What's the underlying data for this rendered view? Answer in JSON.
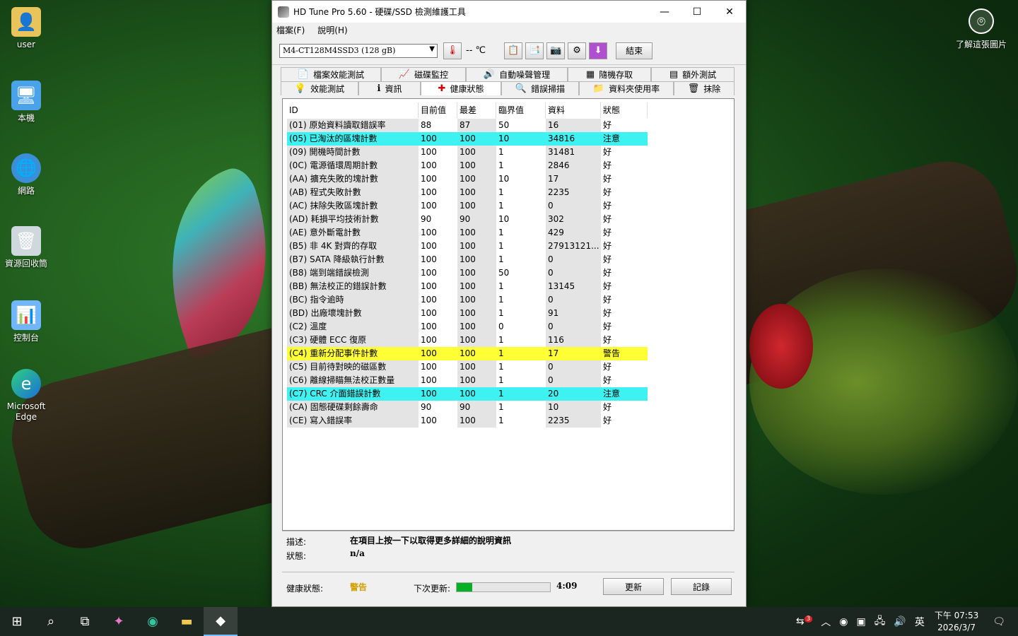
{
  "desktop": {
    "icons": [
      {
        "label": "user",
        "icon": "folder-user-icon"
      },
      {
        "label": "本機",
        "icon": "computer-icon"
      },
      {
        "label": "網路",
        "icon": "network-icon"
      },
      {
        "label": "資源回收筒",
        "icon": "recycle-bin-icon"
      },
      {
        "label": "控制台",
        "icon": "control-panel-icon"
      },
      {
        "label": "Microsoft Edge",
        "icon": "edge-icon"
      }
    ],
    "spotlight_label": "了解這張圖片"
  },
  "window": {
    "title": "HD Tune Pro 5.60 - 硬碟/SSD 檢測維護工具",
    "menu": [
      "檔案(F)",
      "說明(H)"
    ],
    "drive": "M4-CT128M4SSD3 (128 gB)",
    "temperature": "-- ℃",
    "exit_label": "結束",
    "tabs_row1": [
      {
        "label": "檔案效能測試",
        "icon": "file-benchmark-icon"
      },
      {
        "label": "磁碟監控",
        "icon": "disk-monitor-icon"
      },
      {
        "label": "自動噪聲管理",
        "icon": "speaker-icon"
      },
      {
        "label": "隨機存取",
        "icon": "random-access-icon"
      },
      {
        "label": "額外測試",
        "icon": "extra-tests-icon"
      }
    ],
    "tabs_row2": [
      {
        "label": "效能測試",
        "icon": "benchmark-icon"
      },
      {
        "label": "資訊",
        "icon": "info-icon"
      },
      {
        "label": "健康狀態",
        "icon": "health-icon"
      },
      {
        "label": "錯誤掃描",
        "icon": "error-scan-icon"
      },
      {
        "label": "資料夾使用率",
        "icon": "folder-usage-icon"
      },
      {
        "label": "抹除",
        "icon": "erase-icon"
      }
    ],
    "table": {
      "headers": [
        "ID",
        "目前值",
        "最差",
        "臨界值",
        "資料",
        "狀態"
      ],
      "rows": [
        [
          "(01) 原始資料讀取錯誤率",
          "88",
          "87",
          "50",
          "16",
          "好"
        ],
        [
          "(05) 已淘汰的區塊計數",
          "100",
          "100",
          "10",
          "34816",
          "注意"
        ],
        [
          "(09) 開機時間計數",
          "100",
          "100",
          "1",
          "31481",
          "好"
        ],
        [
          "(0C) 電源循環周期計數",
          "100",
          "100",
          "1",
          "2846",
          "好"
        ],
        [
          "(AA) 擴充失敗的塊計數",
          "100",
          "100",
          "10",
          "17",
          "好"
        ],
        [
          "(AB) 程式失敗計數",
          "100",
          "100",
          "1",
          "2235",
          "好"
        ],
        [
          "(AC) 抹除失敗區塊計數",
          "100",
          "100",
          "1",
          "0",
          "好"
        ],
        [
          "(AD) 耗損平均技術計數",
          "90",
          "90",
          "10",
          "302",
          "好"
        ],
        [
          "(AE) 意外斷電計數",
          "100",
          "100",
          "1",
          "429",
          "好"
        ],
        [
          "(B5) 非 4K 對齊的存取",
          "100",
          "100",
          "1",
          "27913121...",
          "好"
        ],
        [
          "(B7) SATA 降級執行計數",
          "100",
          "100",
          "1",
          "0",
          "好"
        ],
        [
          "(B8) 端到端錯誤檢測",
          "100",
          "100",
          "50",
          "0",
          "好"
        ],
        [
          "(BB) 無法校正的錯誤計數",
          "100",
          "100",
          "1",
          "13145",
          "好"
        ],
        [
          "(BC) 指令逾時",
          "100",
          "100",
          "1",
          "0",
          "好"
        ],
        [
          "(BD) 出廠壞塊計數",
          "100",
          "100",
          "1",
          "91",
          "好"
        ],
        [
          "(C2) 溫度",
          "100",
          "100",
          "0",
          "0",
          "好"
        ],
        [
          "(C3) 硬體 ECC 復原",
          "100",
          "100",
          "1",
          "116",
          "好"
        ],
        [
          "(C4) 重新分配事件計數",
          "100",
          "100",
          "1",
          "17",
          "警告"
        ],
        [
          "(C5) 目前待對映的磁區數",
          "100",
          "100",
          "1",
          "0",
          "好"
        ],
        [
          "(C6) 離線掃瞄無法校正數量",
          "100",
          "100",
          "1",
          "0",
          "好"
        ],
        [
          "(C7) CRC 介面錯誤計數",
          "100",
          "100",
          "1",
          "20",
          "注意"
        ],
        [
          "(CA) 固態硬碟剩餘壽命",
          "90",
          "90",
          "1",
          "10",
          "好"
        ],
        [
          "(CE) 寫入錯誤率",
          "100",
          "100",
          "1",
          "2235",
          "好"
        ]
      ]
    },
    "description_label": "描述:",
    "description_value": "在項目上按一下以取得更多詳細的說明資訊",
    "state_label": "狀態:",
    "state_value": "n/a",
    "health_label": "健康狀態:",
    "health_value": "警告",
    "next_update_label": "下次更新:",
    "next_update_progress": 0.17,
    "next_update_time": "4:09",
    "refresh_label": "更新",
    "log_label": "記錄"
  },
  "taskbar": {
    "clock_time": "下午 07:53",
    "clock_date": "2026/3/7",
    "ime": "英",
    "notification_badge": "3"
  },
  "colors": {
    "notice_row": "#3ff2f2",
    "warning_row": "#ffff36",
    "health_warning_text": "#d4a000",
    "progress_fill": "#06b025"
  }
}
